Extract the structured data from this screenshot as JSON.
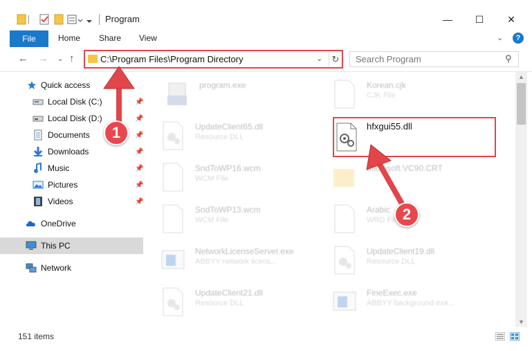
{
  "window": {
    "title": "Program",
    "minimize_glyph": "—",
    "maximize_glyph": "☐",
    "close_glyph": "✕"
  },
  "ribbon": {
    "file_tab": "File",
    "tabs": [
      "Home",
      "Share",
      "View"
    ],
    "help_glyph": "?"
  },
  "address": {
    "path": "C:\\Program Files\\Program Directory",
    "search_placeholder": "Search Program"
  },
  "sidebar": {
    "quick_access": "Quick access",
    "items": [
      {
        "label": "Local Disk (C:)",
        "icon": "drive-icon"
      },
      {
        "label": "Local Disk (D:)",
        "icon": "drive-icon"
      },
      {
        "label": "Documents",
        "icon": "documents-icon"
      },
      {
        "label": "Downloads",
        "icon": "downloads-icon"
      },
      {
        "label": "Music",
        "icon": "music-icon"
      },
      {
        "label": "Pictures",
        "icon": "pictures-icon"
      },
      {
        "label": "Videos",
        "icon": "videos-icon"
      }
    ],
    "onedrive": "OneDrive",
    "this_pc": "This PC",
    "network": "Network"
  },
  "files": [
    {
      "name": "program.exe",
      "type": ""
    },
    {
      "name": "Korean.cjk",
      "type": "CJK File"
    },
    {
      "name": "UpdateClient65.dll",
      "type": "Resource DLL"
    },
    {
      "name": "hfxgui55.dll",
      "type": ""
    },
    {
      "name": "SndToWP16.wcm",
      "type": "WCM File"
    },
    {
      "name": "Microsoft.VC90.CRT",
      "type": ""
    },
    {
      "name": "SndToWP13.wcm",
      "type": "WCM File"
    },
    {
      "name": "Arabic",
      "type": "WRD File"
    },
    {
      "name": "NetworkLicenseServer.exe",
      "type": "ABBYY network licens..."
    },
    {
      "name": "UpdateClient19.dll",
      "type": "Resource DLL"
    },
    {
      "name": "UpdateClient21.dll",
      "type": "Resource DLL"
    },
    {
      "name": "FineExec.exe",
      "type": "ABBYY background exe..."
    }
  ],
  "status": {
    "item_count": "151 items"
  },
  "annotations": {
    "step1": "1",
    "step2": "2",
    "color": "#e2454a"
  },
  "colors": {
    "accent": "#1979ca",
    "folder": "#f5c646",
    "selected": "#d9d9d9"
  }
}
